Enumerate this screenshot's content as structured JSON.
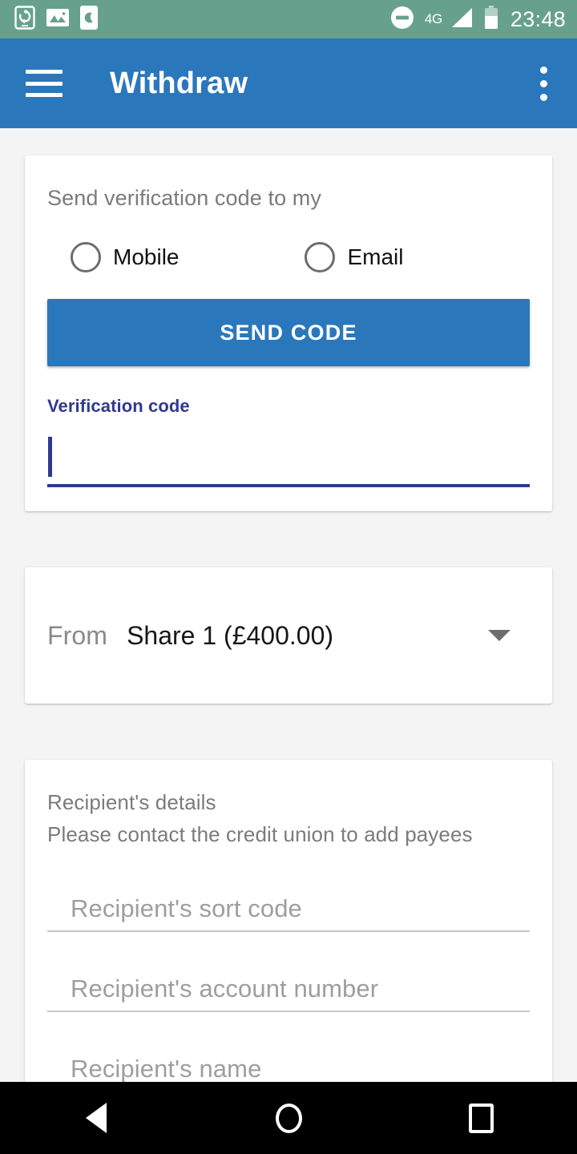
{
  "status_bar": {
    "icons": [
      "phone-sync-icon",
      "image-icon",
      "phone-moon-icon"
    ],
    "dnd_icon": "do-not-disturb-icon",
    "network_label": "4G",
    "signal_icon": "signal-bars-icon",
    "battery_icon": "battery-icon",
    "time": "23:48",
    "background_color": "#67a18d"
  },
  "app_bar": {
    "menu_icon": "hamburger-menu-icon",
    "title": "Withdraw",
    "overflow_icon": "more-vertical-icon",
    "background_color": "#2b77bc"
  },
  "verification_card": {
    "prompt": "Send verification code to my",
    "options": [
      {
        "label": "Mobile",
        "selected": false
      },
      {
        "label": "Email",
        "selected": false
      }
    ],
    "send_button_label": "SEND CODE",
    "send_button_color": "#2b77bc",
    "code_field": {
      "label": "Verification code",
      "value": "",
      "focused": true,
      "accent_color": "#2f3a8f"
    }
  },
  "from_card": {
    "label": "From",
    "selected_account": "Share 1 (£400.00)",
    "dropdown_icon": "chevron-down-icon"
  },
  "recipient_card": {
    "title": "Recipient's details",
    "subtitle": "Please contact the credit union to add payees",
    "fields": [
      {
        "placeholder": "Recipient's sort code",
        "value": ""
      },
      {
        "placeholder": "Recipient's account number",
        "value": ""
      },
      {
        "placeholder": "Recipient's name",
        "value": ""
      }
    ]
  },
  "nav_bar": {
    "back_label": "back-button",
    "home_label": "home-button",
    "recents_label": "recents-button"
  }
}
